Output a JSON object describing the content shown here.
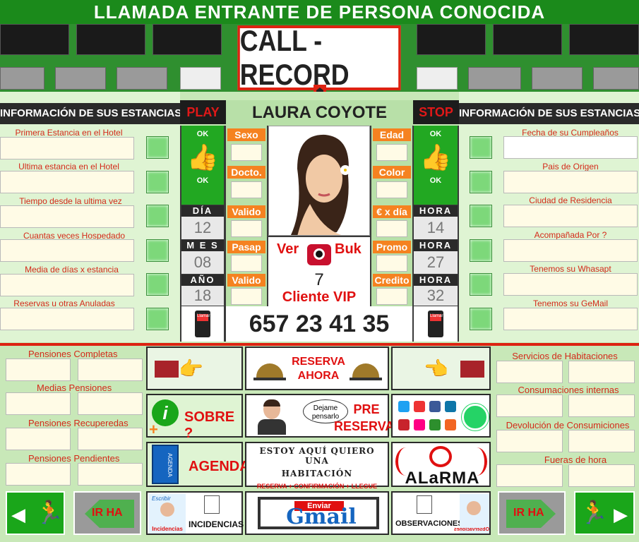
{
  "header": {
    "title": "LLAMADA  ENTRANTE DE PERSONA CONOCIDA"
  },
  "app": {
    "title": "CALL   - RECORD"
  },
  "controls": {
    "play": "PLAY",
    "stop": "STOP"
  },
  "contact": {
    "name": "LAURA COYOTE",
    "phone": "657 23 41 35",
    "client_count": "7",
    "client_label": "Cliente VIP",
    "ver": "Ver",
    "buk": "Buk"
  },
  "left_panel": {
    "heading": "INFORMACIÓN DE SUS ESTANCIAS",
    "labels": [
      "Primera Estancia en el Hotel",
      "Ultima estancia en el Hotel",
      "Tiempo desde la ultima vez",
      "Cuantas veces Hospedado",
      "Media de días x estancia",
      "Reservas u otras Anuladas"
    ]
  },
  "right_panel": {
    "heading": "INFORMACIÓN DE SUS ESTANCIAS",
    "labels": [
      "Fecha de su Cumpleaños",
      "Pais de Origen",
      "Ciudad de Residencia",
      "Acompañada Por ?",
      "Tenemos su Whasapt",
      "Tenemos su GeMail"
    ]
  },
  "ok_labels": {
    "top": "OK",
    "bottom": "OK"
  },
  "center_left": {
    "sexo": "Sexo",
    "docto": "Docto.",
    "valido1": "Valido",
    "pasap": "Pasap",
    "valido2": "Valido"
  },
  "center_right": {
    "edad": "Edad",
    "color": "Color",
    "eur": "€ x día",
    "promo": "Promo",
    "credito": "Credito"
  },
  "dates": {
    "dia_label": "DÍA",
    "dia": "12",
    "mes_label": "M E S",
    "mes": "08",
    "ano_label": "AÑO",
    "ano": "18",
    "hora_label": "HORA",
    "hora1": "14",
    "hora2": "27",
    "hora3": "32"
  },
  "phone_icon_text": "Llamar",
  "bottom_left": {
    "labels": [
      "Pensiones Completas",
      "Medias Pensiones",
      "Pensiones Recuperedas",
      "Pensiones Pendientes"
    ]
  },
  "bottom_right": {
    "labels": [
      "Servicios de Habitaciones",
      "Consumaciones internas",
      "Devolución de Consumiciones",
      "Fueras de hora"
    ]
  },
  "actions": {
    "reserva_ahora_1": "RESERVA",
    "reserva_ahora_2": "AHORA",
    "sobre": "SOBRE ?",
    "dejame": "Dejame pensarlo",
    "pre_reserva_1": "PRE",
    "pre_reserva_2": "RESERVA",
    "agenda": "AGENDA",
    "agenda_tab": "AGENDA",
    "estoy_1": "ESTOY AQUÍ QUIERO UNA",
    "estoy_2": "HABITACIÓN",
    "estoy_3": "RESERVA + CONFIRMACIÓN + LLEGUE",
    "alarma": "ALaRMA",
    "ir_ha": "IR HA",
    "incidencias": "INCIDENCIAS",
    "incidencias_small": "Incidencias",
    "escribir": "Escribir",
    "enviar": "Enviar",
    "gmail": "Gmail",
    "observaciones": "OBSERVACIONES",
    "observaciones_small": "Observaciones"
  },
  "colors": {
    "accent": "#d21f1f",
    "green": "#22a822",
    "orange": "#f58220"
  }
}
